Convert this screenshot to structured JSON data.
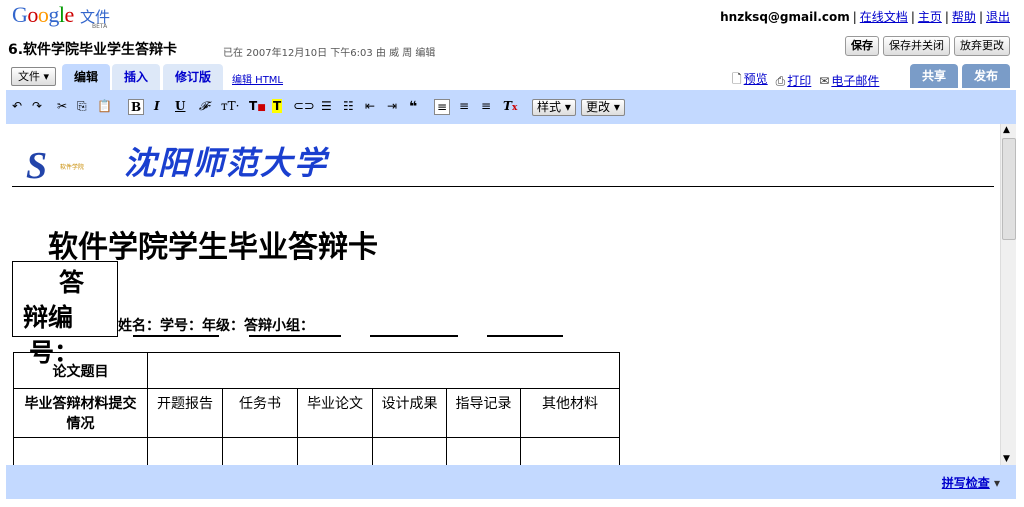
{
  "app": {
    "logo_google": "Google",
    "logo_wenjian": "文件",
    "logo_beta": "BETA"
  },
  "user": {
    "email": "hnzksq@gmail.com",
    "links": [
      "在线文档",
      "主页",
      "帮助",
      "退出"
    ]
  },
  "document": {
    "title": "6.软件学院毕业学生答辩卡",
    "saved_info": "已在 2007年12月10日 下午6:03 由 威 周 编辑"
  },
  "actions": {
    "save": "保存",
    "save_close": "保存并关闭",
    "discard": "放弃更改"
  },
  "menus": {
    "file": "文件",
    "tabs": [
      "编辑",
      "插入",
      "修订版"
    ],
    "edit_html": "编辑 HTML",
    "preview": "预览",
    "print": "打印",
    "email": "电子邮件",
    "share": "共享",
    "publish": "发布"
  },
  "toolbar": {
    "style": "样式",
    "change": "更改"
  },
  "status": {
    "spellcheck": "拼写检查"
  },
  "content": {
    "univ": "沈阳师范大学",
    "logo_sub": "软件学院",
    "heading": "软件学院学生毕业答辩卡",
    "textbox": [
      "答",
      "辩编",
      "号："
    ],
    "info": "姓名：学号：年级：答辩小组：",
    "row1": [
      "论文题目"
    ],
    "row2": [
      "毕业答辩材料提交情况",
      "开题报告",
      "任务书",
      "毕业论文",
      "设计成果",
      "指导记录",
      "其他材料"
    ]
  },
  "colors": {
    "toolbar": "#c3d9ff",
    "link": "#0000cc",
    "univ": "#1a3fcf"
  }
}
